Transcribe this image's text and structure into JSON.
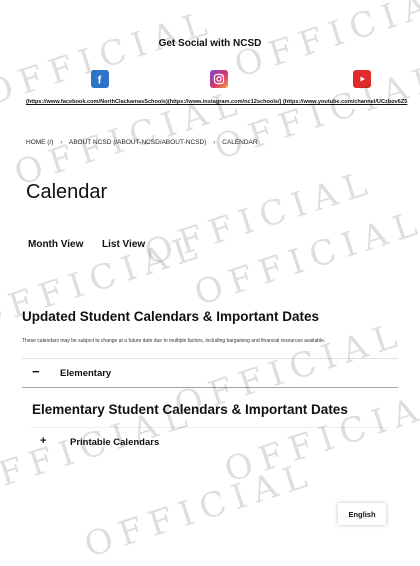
{
  "social": {
    "title": "Get Social with NCSD",
    "links": [
      {
        "label": "(https://www.facebook.com/NorthClackamasSchools)",
        "icon": "facebook-icon",
        "color": "#2f72c8"
      },
      {
        "label": "(https://www.instagram.com/nc12schools/)",
        "icon": "instagram-icon",
        "color": "#d4336d"
      },
      {
        "label": "(https://www.youtube.com/channel/UCzbov6Z5",
        "icon": "youtube-icon",
        "color": "#e02b2b"
      }
    ]
  },
  "breadcrumb": {
    "home": "HOME (/)",
    "about": "ABOUT NCSD (/ABOUT-NCSD/ABOUT-NCSD)",
    "current": "CALENDAR",
    "separator": "›"
  },
  "page": {
    "title": "Calendar"
  },
  "views": {
    "month": "Month View",
    "list": "List View"
  },
  "section": {
    "title": "Updated Student Calendars & Important Dates",
    "disclaimer": "These calendars may be subject to change at a future date due to multiple factors, including bargaining and financial resources available."
  },
  "accordion": {
    "symbol": "−",
    "label": "Elementary"
  },
  "elementary": {
    "title": "Elementary Student Calendars & Important Dates",
    "printable": {
      "symbol": "+",
      "label": "Printable Calendars"
    }
  },
  "language": {
    "label": "English"
  },
  "watermark": {
    "text": "OFFICIAL"
  }
}
